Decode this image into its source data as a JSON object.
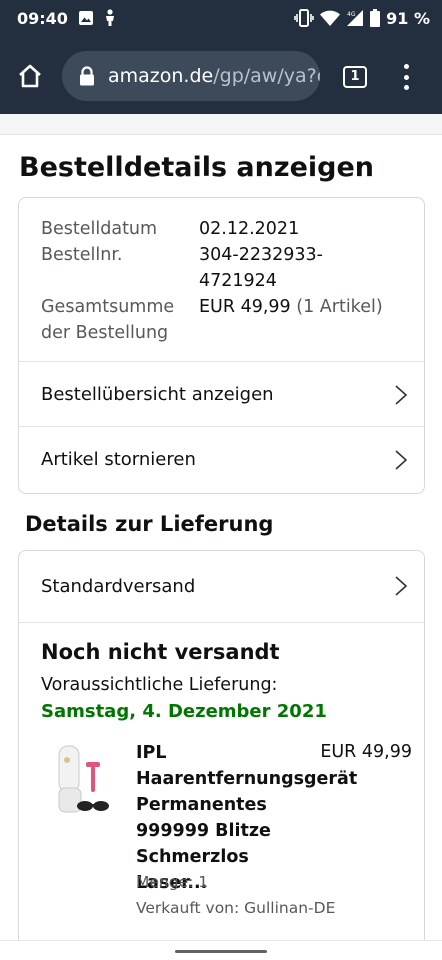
{
  "status_bar": {
    "time": "09:40",
    "battery": "91 %"
  },
  "browser": {
    "url_domain": "amazon.de",
    "url_path": "/gp/aw/ya?o",
    "tab_count": "1"
  },
  "page": {
    "title": "Bestelldetails anzeigen"
  },
  "order": {
    "date_label": "Bestelldatum",
    "date_value": "02.12.2021",
    "number_label": "Bestellnr.",
    "number_value": "304-2232933-4721924",
    "total_label": "Gesamtsumme der Bestellung",
    "total_value": "EUR 49,99",
    "total_items": "(1 Artikel)",
    "links": [
      {
        "label": "Bestellübersicht anzeigen"
      },
      {
        "label": "Artikel stornieren"
      }
    ]
  },
  "delivery": {
    "section_title": "Details zur Lieferung",
    "shipping_method": "Standardversand",
    "status": "Noch nicht versandt",
    "expected_label": "Voraussichtliche Lieferung:",
    "expected_date": "Samstag, 4. Dezember 2021",
    "item": {
      "title": "IPL Haarentfernungsgerät Permanentes 999999 Blitze Schmerzlos Laser...",
      "price": "EUR 49,99",
      "quantity": "Menge: 1",
      "seller": "Verkauft von: Gullinan-DE"
    }
  },
  "colors": {
    "header_bg": "#232f3e",
    "delivery_date": "#007600",
    "muted_text": "#565959"
  }
}
